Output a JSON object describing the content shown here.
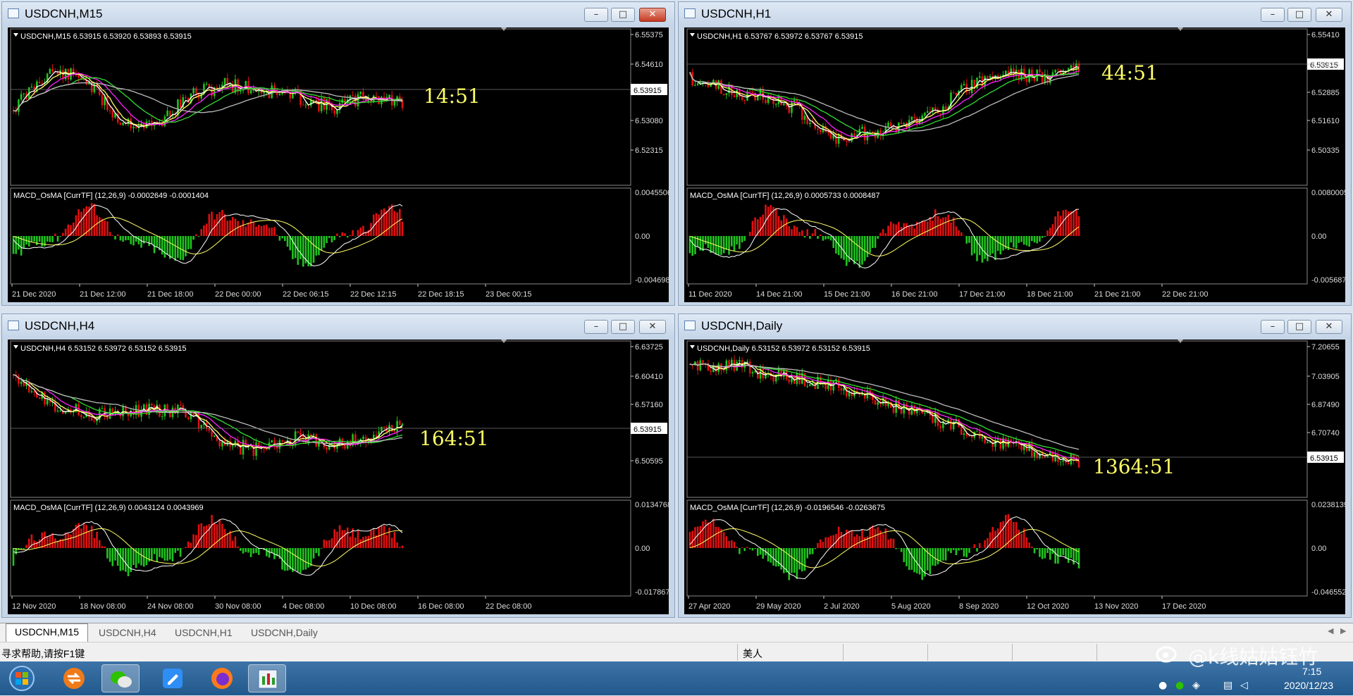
{
  "windows": [
    {
      "title": "USDCNH,M15",
      "info": "USDCNH,M15  6.53915 6.53920 6.53893 6.53915",
      "price_axis": [
        "6.55375",
        "6.54610",
        "6.53080",
        "6.52315"
      ],
      "current_price": "6.53915",
      "timer": "14:51",
      "macd_label": "MACD_OsMA [CurrTF] (12,26,9) -0.0002649 -0.0001404",
      "macd_axis": [
        "0.0045506",
        "0.00",
        "-0.0046982"
      ],
      "time_axis": [
        "21 Dec 2020",
        "21 Dec 12:00",
        "21 Dec 18:00",
        "22 Dec 00:00",
        "22 Dec 06:15",
        "22 Dec 12:15",
        "22 Dec 18:15",
        "23 Dec 00:15"
      ]
    },
    {
      "title": "USDCNH,H1",
      "info": "USDCNH,H1  6.53767 6.53972 6.53767 6.53915",
      "price_axis": [
        "6.55410",
        "6.54135",
        "6.52885",
        "6.51610",
        "6.50335"
      ],
      "current_price": "6.53915",
      "timer": "44:51",
      "macd_label": "MACD_OsMA [CurrTF] (12,26,9) 0.0005733 0.0008487",
      "macd_axis": [
        "0.0080005",
        "0.00",
        "-0.0056875"
      ],
      "time_axis": [
        "11 Dec 2020",
        "14 Dec 21:00",
        "15 Dec 21:00",
        "16 Dec 21:00",
        "17 Dec 21:00",
        "18 Dec 21:00",
        "21 Dec 21:00",
        "22 Dec 21:00"
      ]
    },
    {
      "title": "USDCNH,H4",
      "info": "USDCNH,H4  6.53152 6.53972 6.53152 6.53915",
      "price_axis": [
        "6.63725",
        "6.60410",
        "6.57160",
        "6.50595"
      ],
      "current_price": "6.53915",
      "timer": "164:51",
      "macd_label": "MACD_OsMA [CurrTF] (12,26,9) 0.0043124 0.0043969",
      "macd_axis": [
        "0.0134768",
        "0.00",
        "-0.0178674"
      ],
      "time_axis": [
        "12 Nov 2020",
        "18 Nov 08:00",
        "24 Nov 08:00",
        "30 Nov 08:00",
        "4 Dec 08:00",
        "10 Dec 08:00",
        "16 Dec 08:00",
        "22 Dec 08:00"
      ]
    },
    {
      "title": "USDCNH,Daily",
      "info": "USDCNH,Daily  6.53152 6.53972 6.53152 6.53915",
      "price_axis": [
        "7.20655",
        "7.03905",
        "6.87490",
        "6.70740"
      ],
      "current_price": "6.53915",
      "timer": "1364:51",
      "macd_label": "MACD_OsMA [CurrTF] (12,26,9) -0.0196546 -0.0263675",
      "macd_axis": [
        "0.0238139",
        "0.00",
        "-0.046552"
      ],
      "time_axis": [
        "27 Apr 2020",
        "29 May 2020",
        "2 Jul 2020",
        "5 Aug 2020",
        "8 Sep 2020",
        "12 Oct 2020",
        "13 Nov 2020",
        "17 Dec 2020"
      ]
    }
  ],
  "tabs": [
    "USDCNH,M15",
    "USDCNH,H4",
    "USDCNH,H1",
    "USDCNH,Daily"
  ],
  "status": {
    "help": "寻求帮助,请按F1键",
    "profile": "美人"
  },
  "clock": {
    "time": "7:15",
    "date": "2020/12/23"
  },
  "watermark": "@k线姑姑钰竹",
  "colors": {
    "bull": "#1fc41f",
    "bear": "#e01010",
    "ma_fast": "#ffffff",
    "ma_2": "#ffff66",
    "ma_3": "#ff22ff",
    "ma_4": "#33dd33",
    "ma_5": "#bbbbbb",
    "timer": "#ffff66"
  }
}
